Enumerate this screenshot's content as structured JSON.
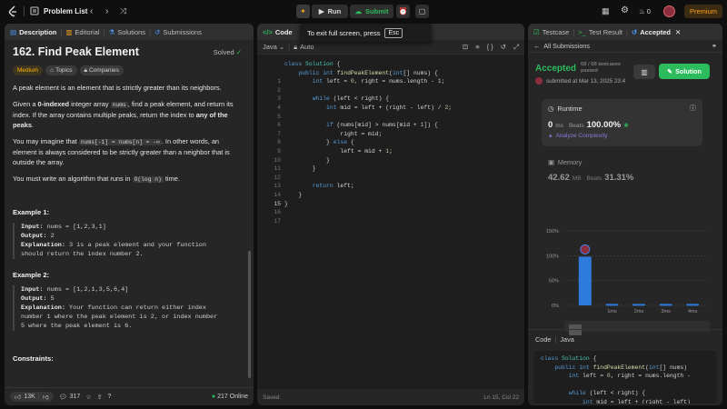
{
  "topbar": {
    "list_label": "Problem List",
    "run": "Run",
    "submit": "Submit",
    "fire_count": "0",
    "premium": "Premium"
  },
  "toast": {
    "text": "To exit full screen, press",
    "key": "Esc"
  },
  "left": {
    "tabs": [
      "Description",
      "Editorial",
      "Solutions",
      "Submissions"
    ],
    "title": "162. Find Peak Element",
    "solved": "Solved",
    "tags": [
      "Medium",
      "Topics",
      "Companies"
    ],
    "p1": "A peak element is an element that is strictly greater than its neighbors.",
    "p2_a": "Given a ",
    "p2_b": "0-indexed",
    "p2_c": " integer array ",
    "p2_code": "nums",
    "p2_d": ", find a peak element, and return its index. If the array contains multiple peaks, return the index to ",
    "p2_e": "any of the peaks",
    "p2_f": ".",
    "p3_a": "You may imagine that ",
    "p3_code1": "nums[-1] = nums[n] = -∞",
    "p3_b": ". In other words, an element is always considered to be strictly greater than a neighbor that is outside the array.",
    "p4_a": "You must write an algorithm that runs in ",
    "p4_code": "O(log n)",
    "p4_b": " time.",
    "ex1_title": "Example 1:",
    "ex1_input": "nums = [1,2,3,1]",
    "ex1_output": "2",
    "ex1_expl": "3 is a peak element and your function\nshould return the index number 2.",
    "ex2_title": "Example 2:",
    "ex2_input": "nums = [1,2,1,3,5,6,4]",
    "ex2_output": "5",
    "ex2_expl": "Your function can return either index\nnumber 1 where the peak element is 2, or index number\n5 where the peak element is 6.",
    "input_label": "Input:",
    "output_label": "Output:",
    "expl_label": "Explanation:",
    "constraints": "Constraints:",
    "likes": "13K",
    "comments": "317",
    "online": "217 Online"
  },
  "editor": {
    "tab": "Code",
    "lang": "Java",
    "auto": "Auto",
    "saved": "Saved",
    "cursor": "Ln 15, Col 22",
    "line_numbers": [
      "1",
      "2",
      "3",
      "4",
      "5",
      "6",
      "7",
      "8",
      "9",
      "10",
      "11",
      "12",
      "13",
      "14",
      "15",
      "16",
      "17"
    ]
  },
  "right": {
    "tabs": [
      "Testcase",
      "Test Result",
      "Accepted"
    ],
    "back": "All Submissions",
    "status": "Accepted",
    "passed": "68 / 68 testcases passed",
    "submitted": "submitted at Mar 13, 2025 23:4",
    "solution_btn": "Solution",
    "runtime_label": "Runtime",
    "runtime_value": "0",
    "runtime_unit": "ms",
    "beats_label": "Beats",
    "runtime_beats": "100.00%",
    "analyze": "Analyze Complexity",
    "memory_label": "Memory",
    "memory_value": "42.62",
    "memory_unit": "MB",
    "memory_beats": "31.31%",
    "code_label": "Code",
    "code_lang": "Java"
  },
  "chart_data": {
    "type": "bar",
    "yticks": [
      "150%",
      "100%",
      "50%",
      "0%"
    ],
    "categories": [
      "",
      "1ms",
      "2ms",
      "3ms",
      "4ms"
    ],
    "values": [
      98,
      3,
      3,
      3,
      3
    ],
    "ylim": [
      0,
      150
    ],
    "highlight_color": "#2f7bdc"
  }
}
